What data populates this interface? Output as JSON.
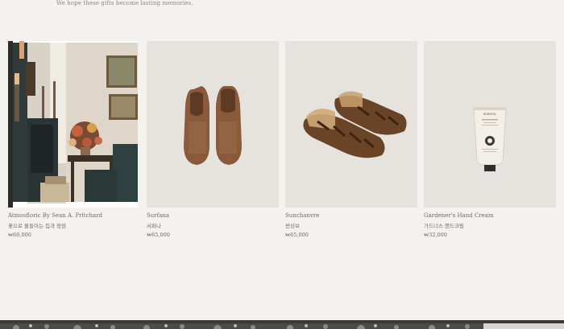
{
  "intro": {
    "tagline": "We hope these gifts become lasting memories."
  },
  "products": [
    {
      "name_en": "Atmosfloric By Sean A. Pritchard",
      "name_ko": "꽃으로 물들이는 집과 정원",
      "price": "₩60,000",
      "image": "book-room-photo"
    },
    {
      "name_en": "Surfana",
      "name_ko": "서파나",
      "price": "₩65,000",
      "image": "leather-slip-on-shoes"
    },
    {
      "name_en": "Sunchanvre",
      "name_ko": "썬샹브",
      "price": "₩65,000",
      "image": "leather-fisherman-sandals"
    },
    {
      "name_en": "Gardener's Hand Cream",
      "name_ko": "가드너스 핸드크림",
      "price": "₩32,000",
      "image": "hand-cream-tube",
      "tube_label": "BORNTAL"
    }
  ],
  "colors": {
    "background": "#f4f2ee",
    "card_image_bg": "#e6e3de",
    "text": "#6f6a62"
  }
}
